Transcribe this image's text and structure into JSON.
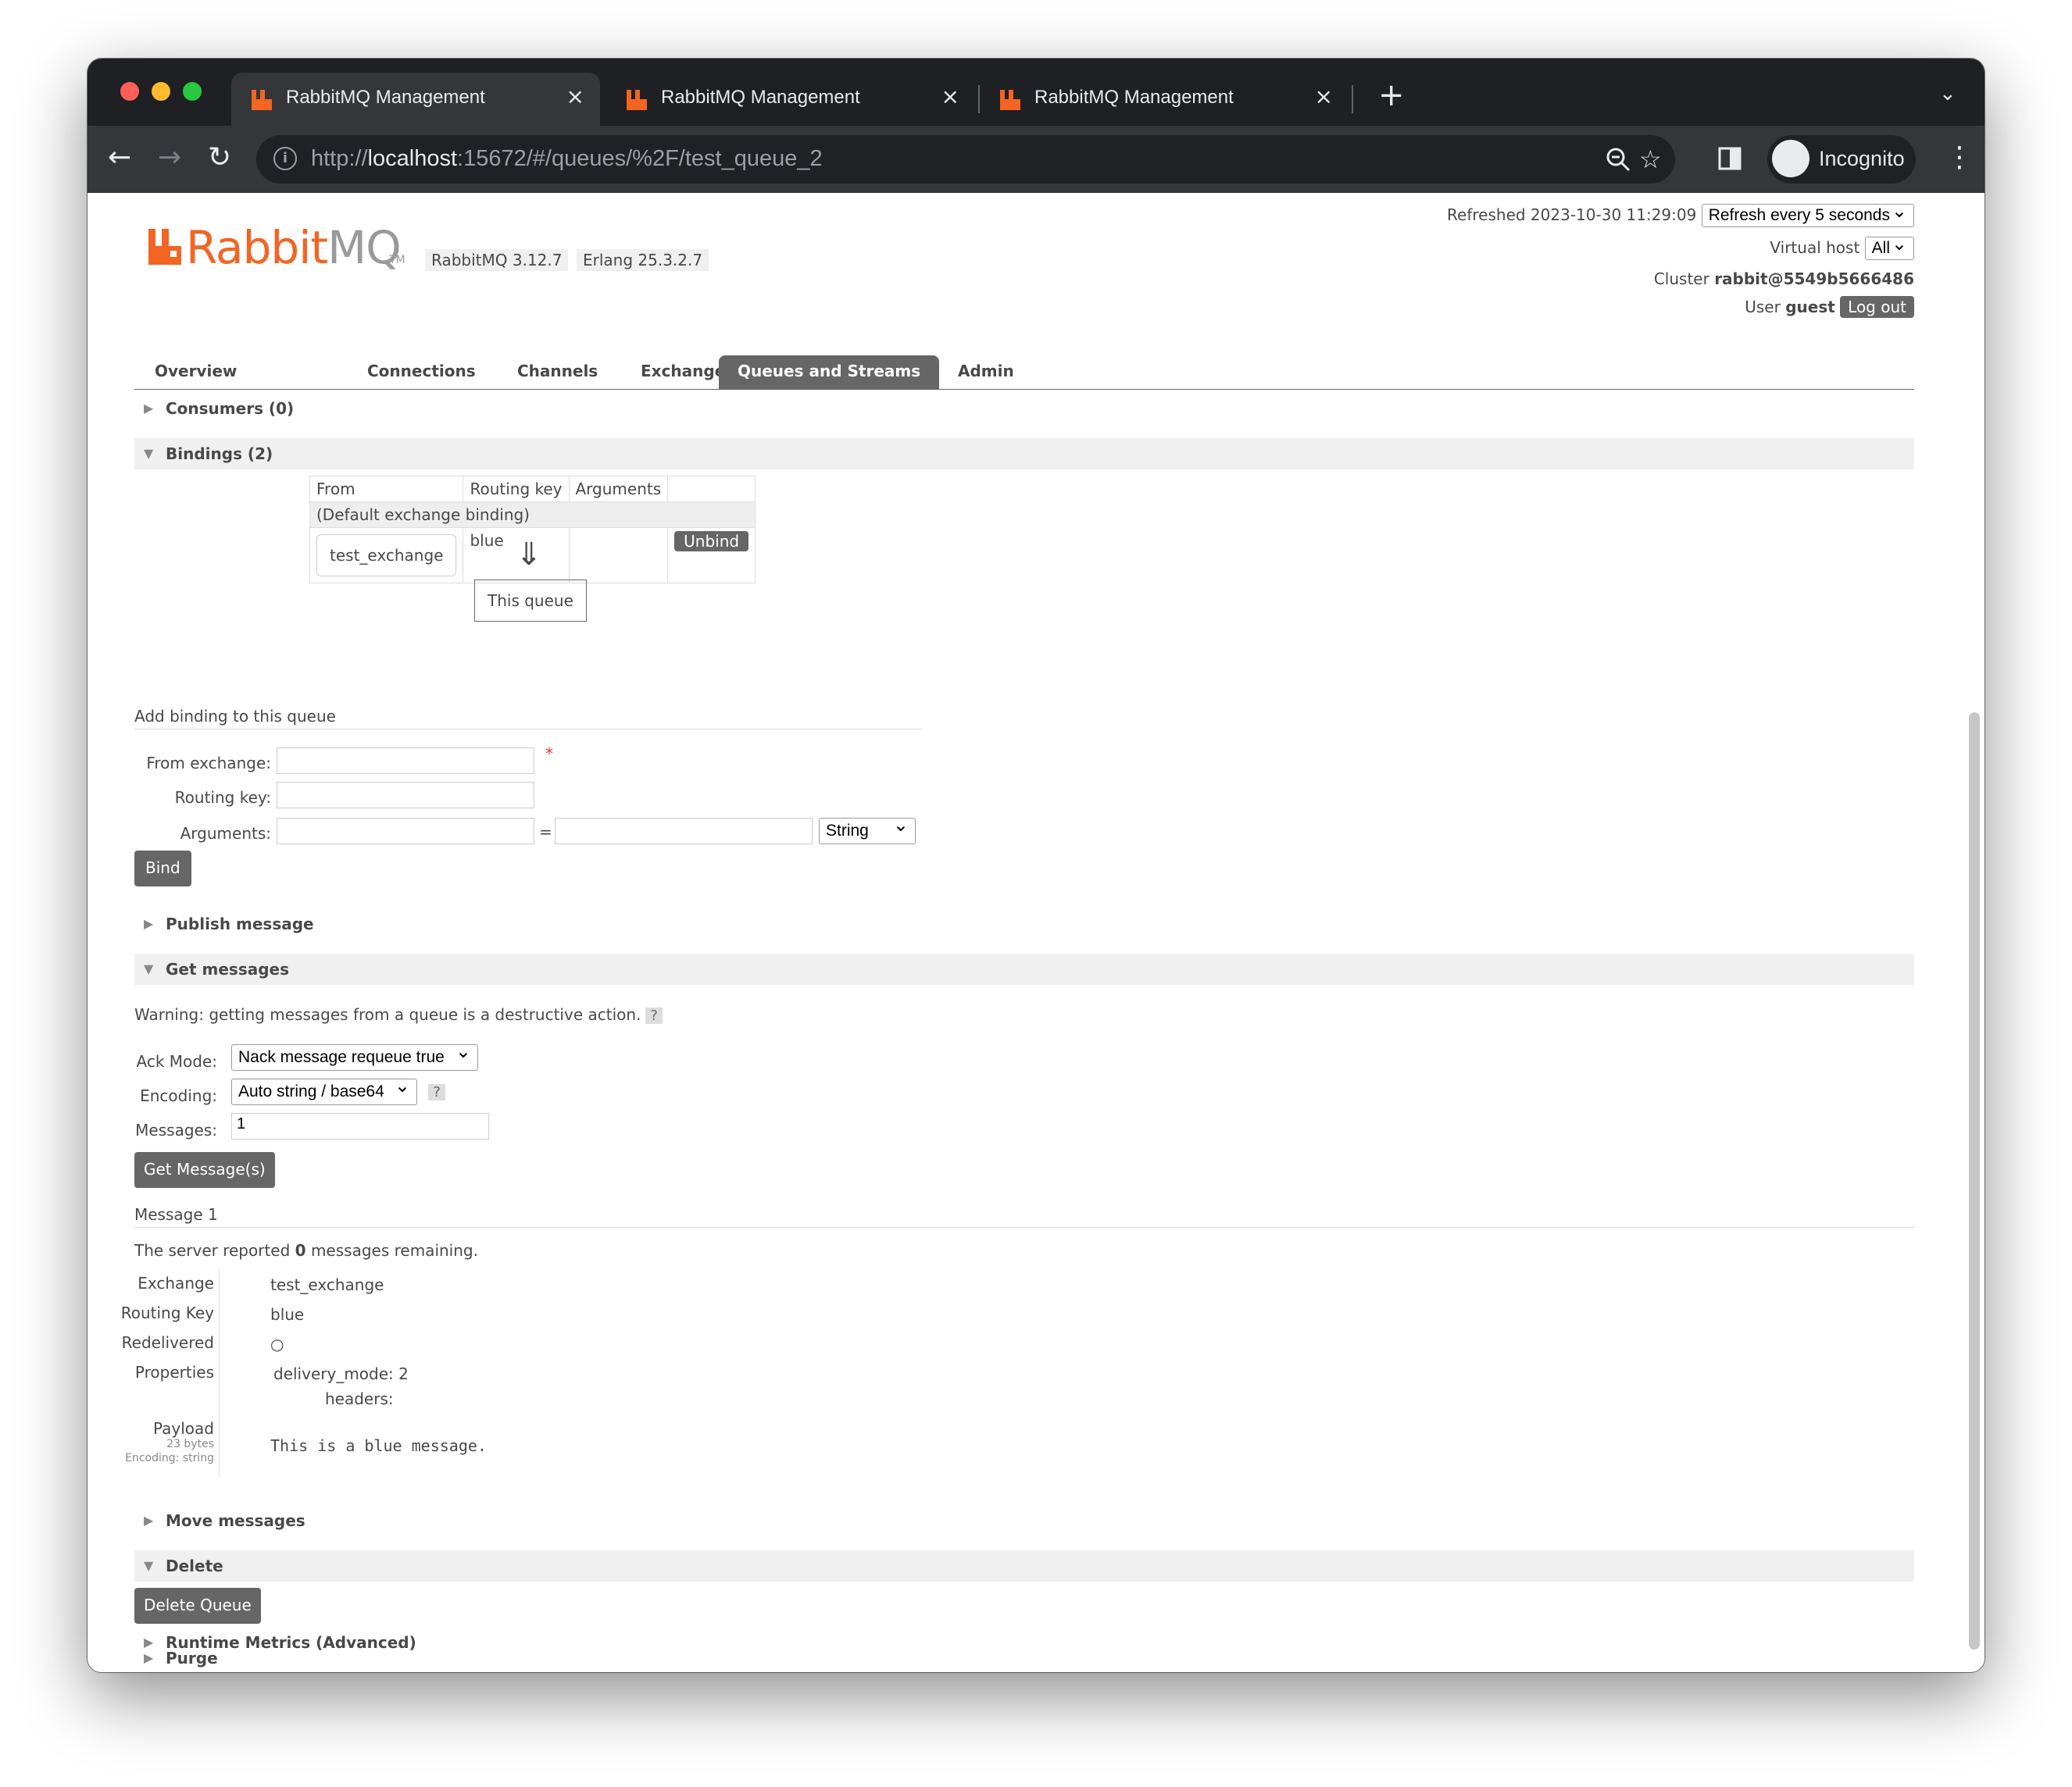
{
  "browser": {
    "tabs": [
      {
        "title": "RabbitMQ Management",
        "close": "×"
      },
      {
        "title": "RabbitMQ Management",
        "close": "×"
      },
      {
        "title": "RabbitMQ Management",
        "close": "×"
      }
    ],
    "new_tab": "+",
    "url_scheme": "http://",
    "url_host": "localhost",
    "url_rest": ":15672/#/queues/%2F/test_queue_2",
    "incognito_label": "Incognito"
  },
  "header": {
    "logo_rabbit": "Rabbit",
    "logo_mq": "MQ",
    "logo_tm": "TM",
    "rabbitmq_version": "RabbitMQ 3.12.7",
    "erlang_version": "Erlang 25.3.2.7",
    "refreshed_label": "Refreshed 2023-10-30 11:29:09",
    "refresh_select": "Refresh every 5 seconds",
    "vhost_label": "Virtual host",
    "vhost_select": "All",
    "cluster_label": "Cluster",
    "cluster_value": "rabbit@5549b5666486",
    "user_label": "User",
    "user_value": "guest",
    "logout_label": "Log out"
  },
  "nav": {
    "items": [
      "Overview",
      "Connections",
      "Channels",
      "Exchanges",
      "Queues and Streams",
      "Admin"
    ],
    "active": "Queues and Streams"
  },
  "sections": {
    "consumers": "Consumers (0)",
    "bindings": "Bindings (2)",
    "publish": "Publish message",
    "get": "Get messages",
    "move": "Move messages",
    "delete": "Delete",
    "purge": "Purge",
    "runtime": "Runtime Metrics (Advanced)"
  },
  "bindings_table": {
    "headers": [
      "From",
      "Routing key",
      "Arguments",
      ""
    ],
    "default_row": "(Default exchange binding)",
    "row": {
      "from": "test_exchange",
      "routing_key": "blue",
      "arguments": "",
      "action": "Unbind"
    },
    "arrow": "⇓",
    "this_queue": "This queue"
  },
  "add_binding": {
    "title": "Add binding to this queue",
    "from_label": "From exchange:",
    "routing_label": "Routing key:",
    "args_label": "Arguments:",
    "equals": "=",
    "type_select": "String",
    "required": "*",
    "bind_button": "Bind"
  },
  "get_messages": {
    "warning": "Warning: getting messages from a queue is a destructive action.",
    "help": "?",
    "ack_label": "Ack Mode:",
    "ack_value": "Nack message requeue true",
    "encoding_label": "Encoding:",
    "encoding_value": "Auto string / base64",
    "messages_label": "Messages:",
    "messages_value": "1",
    "button": "Get Message(s)"
  },
  "message": {
    "title": "Message 1",
    "server_pre": "The server reported ",
    "server_count": "0",
    "server_post": " messages remaining.",
    "exchange_label": "Exchange",
    "exchange_value": "test_exchange",
    "routing_label": "Routing Key",
    "routing_value": "blue",
    "redelivered_label": "Redelivered",
    "redelivered_value": "○",
    "properties_label": "Properties",
    "delivery_mode_label": "delivery_mode:",
    "delivery_mode_value": "2",
    "headers_label": "headers:",
    "payload_label": "Payload",
    "payload_bytes": "23 bytes",
    "payload_encoding": "Encoding: string",
    "payload_value": "This is a blue message."
  },
  "delete": {
    "button": "Delete Queue"
  },
  "colors": {
    "brand_orange": "#f26522",
    "button_gray": "#666666",
    "chrome_dark": "#1f2023",
    "chrome_toolbar": "#35363a"
  }
}
